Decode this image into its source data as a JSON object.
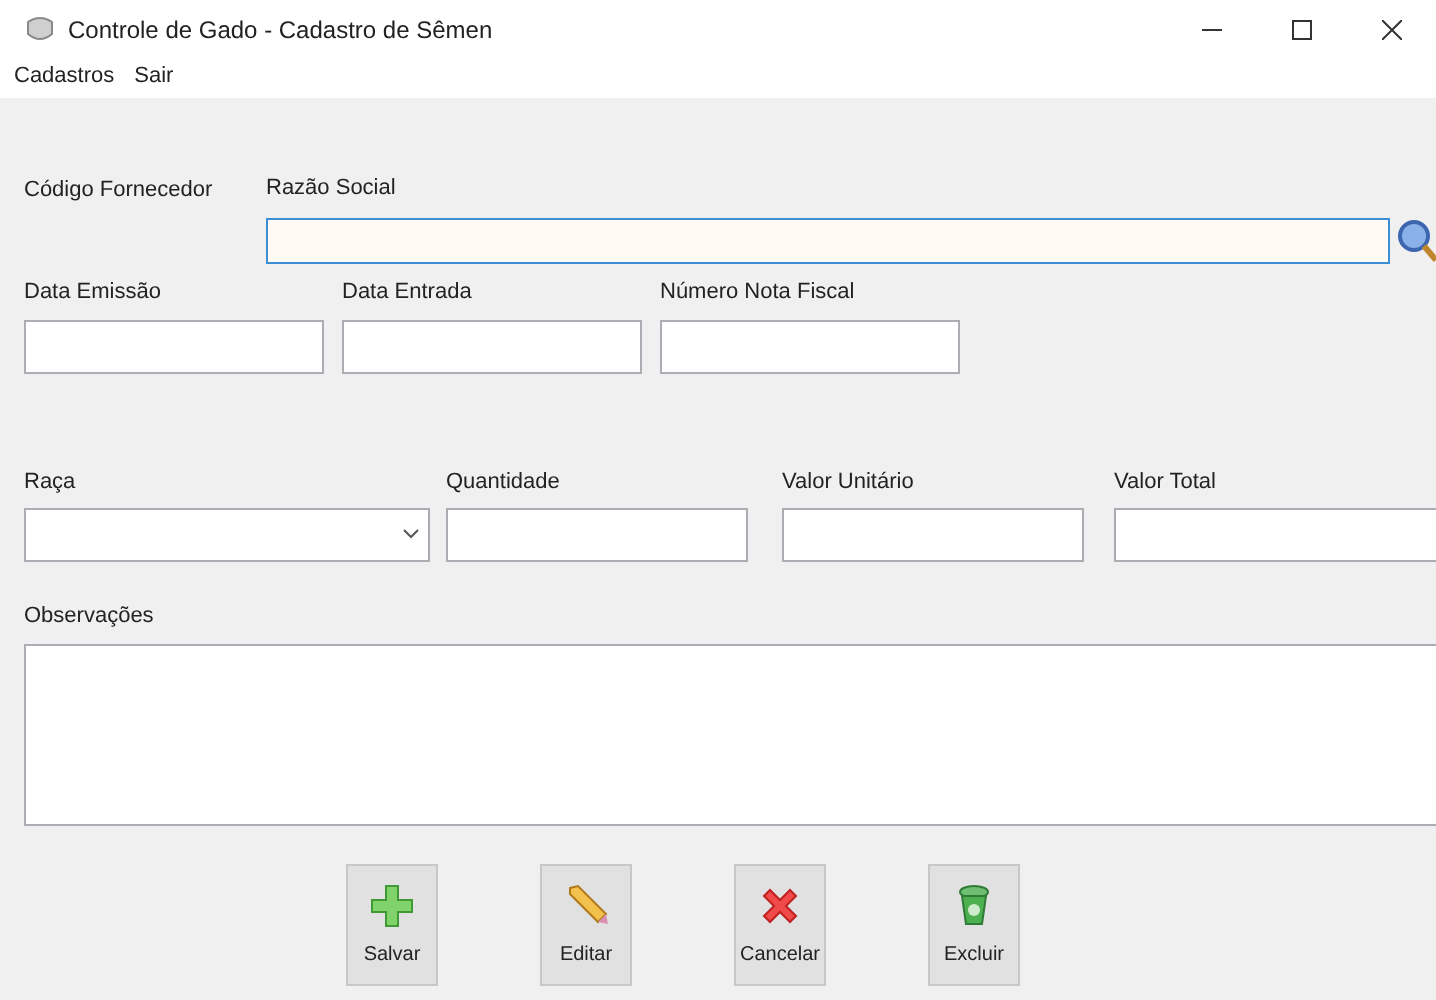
{
  "window": {
    "title": "Controle de Gado - Cadastro de Sêmen"
  },
  "menu": [
    "Cadastros",
    "Sair"
  ],
  "supplier": {
    "code_label": "Código Fornecedor",
    "name_label": "Razão Social",
    "name_focused": true
  },
  "row_dates": [
    {
      "label": "Data Emissão"
    },
    {
      "label": "Data Entrada"
    },
    {
      "label": "Número Nota Fiscal"
    }
  ],
  "row_values": [
    {
      "label": "Raça",
      "kind": "combo"
    },
    {
      "label": "Quantidade",
      "kind": "text"
    },
    {
      "label": "Valor Unitário",
      "kind": "text"
    },
    {
      "label": "Valor Total",
      "kind": "text"
    }
  ],
  "notes": {
    "label": "Observações"
  },
  "buttons": [
    {
      "label": "Salvar",
      "kind": "add"
    },
    {
      "label": "Editar",
      "kind": "edit"
    },
    {
      "label": "Cancelar",
      "kind": "cancel"
    },
    {
      "label": "Excluir",
      "kind": "delete"
    }
  ]
}
